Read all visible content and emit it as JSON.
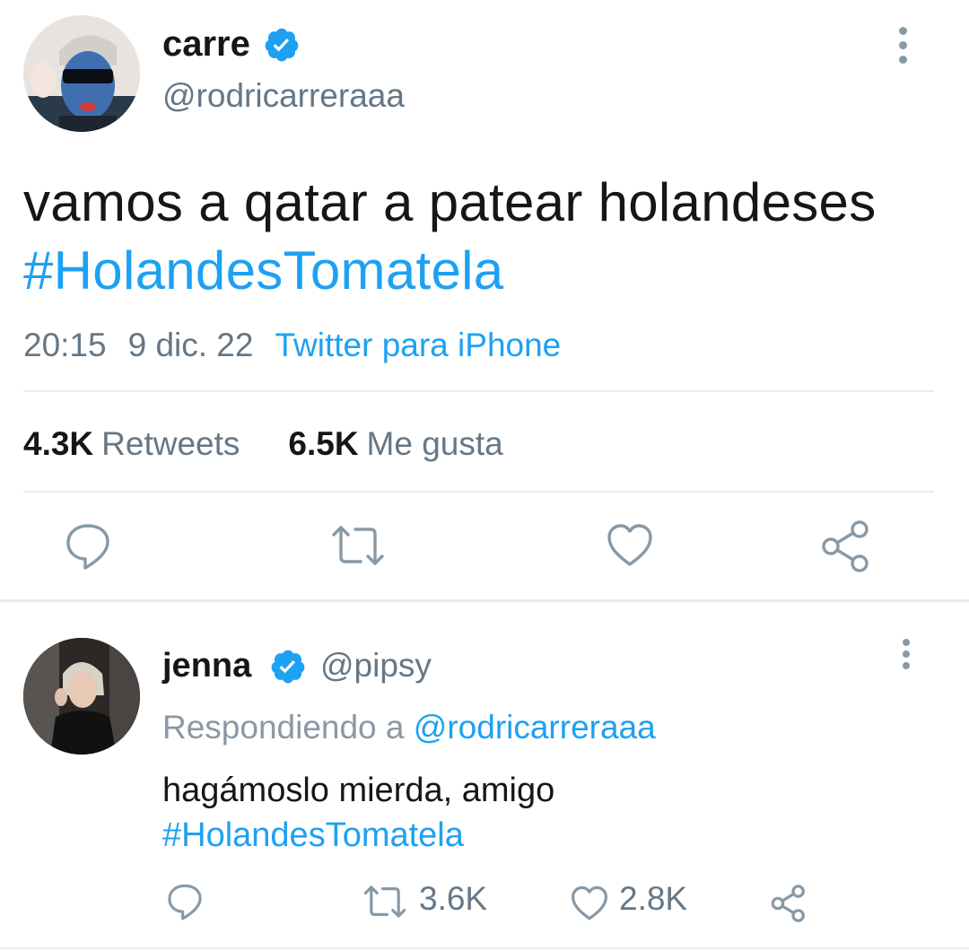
{
  "main_tweet": {
    "author_name": "carre",
    "author_handle": "@rodricarreraaa",
    "text": "vamos a qatar a patear holandeses",
    "hashtag": "#HolandesTomatela",
    "time": "20:15",
    "date": "9 dic. 22",
    "source": "Twitter para iPhone",
    "retweets_count": "4.3K",
    "retweets_label": "Retweets",
    "likes_count": "6.5K",
    "likes_label": "Me gusta",
    "icons": [
      "verified-badge-icon",
      "more-vertical-icon",
      "reply-icon",
      "retweet-icon",
      "like-icon",
      "share-icon"
    ]
  },
  "reply_tweet": {
    "author_name": "jenna",
    "author_handle": "@pipsy",
    "replying_prefix": "Respondiendo a",
    "replying_to": "@rodricarreraaa",
    "text": "hagámoslo mierda, amigo",
    "hashtag": "#HolandesTomatela",
    "retweets_count": "3.6K",
    "likes_count": "2.8K",
    "icons": [
      "verified-badge-icon",
      "more-vertical-icon",
      "reply-icon",
      "retweet-icon",
      "like-icon",
      "share-icon"
    ]
  },
  "colors": {
    "link": "#1da1f2",
    "secondary_text": "#657786",
    "divider": "#e6ecf0",
    "icon": "#8899a6"
  }
}
